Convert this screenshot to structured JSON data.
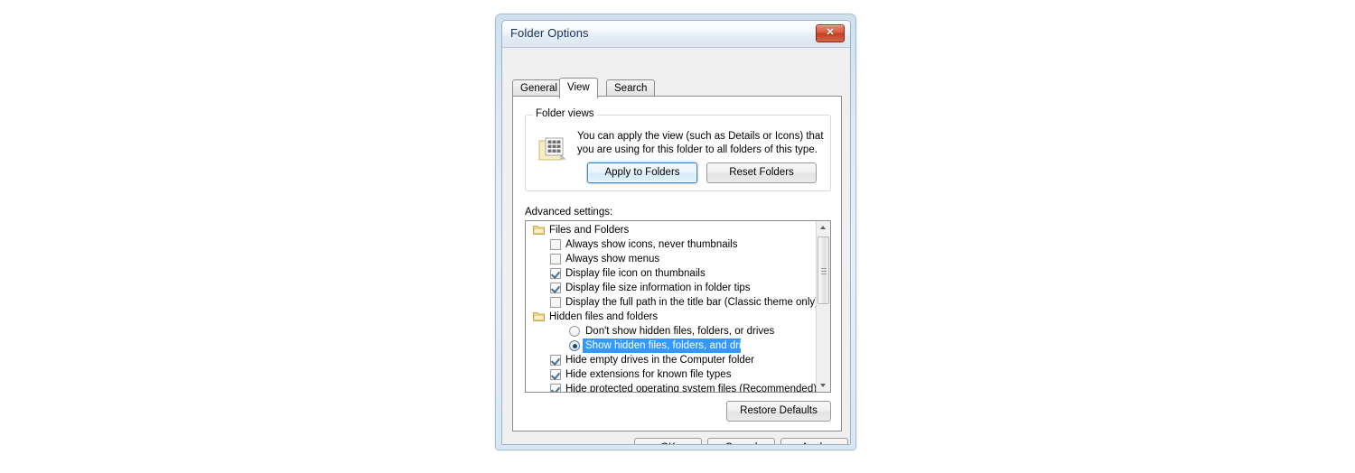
{
  "window": {
    "title": "Folder Options",
    "close_label": "✕",
    "close_icon": "close-icon"
  },
  "tabs": [
    {
      "label": "General",
      "selected": false
    },
    {
      "label": "View",
      "selected": true
    },
    {
      "label": "Search",
      "selected": false
    }
  ],
  "folder_views": {
    "group_title": "Folder views",
    "description": "You can apply the view (such as Details or Icons) that you are using for this folder to all folders of this type.",
    "icon": "folder-view-icon",
    "apply_button": "Apply to Folders",
    "reset_button": "Reset Folders"
  },
  "advanced": {
    "label": "Advanced settings:",
    "items": [
      {
        "type": "group",
        "label": "Files and Folders",
        "icon": "folder-icon"
      },
      {
        "type": "checkbox",
        "label": "Always show icons, never thumbnails",
        "checked": false
      },
      {
        "type": "checkbox",
        "label": "Always show menus",
        "checked": false
      },
      {
        "type": "checkbox",
        "label": "Display file icon on thumbnails",
        "checked": true
      },
      {
        "type": "checkbox",
        "label": "Display file size information in folder tips",
        "checked": true
      },
      {
        "type": "checkbox",
        "label": "Display the full path in the title bar (Classic theme only)",
        "checked": false
      },
      {
        "type": "group",
        "label": "Hidden files and folders",
        "icon": "folder-icon"
      },
      {
        "type": "radio",
        "label": "Don't show hidden files, folders, or drives",
        "selected": false,
        "highlighted": false
      },
      {
        "type": "radio",
        "label": "Show hidden files, folders, and drives",
        "selected": true,
        "highlighted": true
      },
      {
        "type": "checkbox",
        "label": "Hide empty drives in the Computer folder",
        "checked": true
      },
      {
        "type": "checkbox",
        "label": "Hide extensions for known file types",
        "checked": true
      },
      {
        "type": "checkbox",
        "label": "Hide protected operating system files (Recommended)",
        "checked": true
      }
    ],
    "scrollbar": {
      "up_icon": "scroll-up-arrow-icon",
      "down_icon": "scroll-down-arrow-icon"
    },
    "restore_button": "Restore Defaults"
  },
  "footer": {
    "ok": "OK",
    "cancel": "Cancel",
    "apply": "Apply"
  },
  "colors": {
    "selection_blue": "#3399ff",
    "title_text": "#15315b",
    "close_red": "#c23f22",
    "focus_ring": "#3c7fb1"
  }
}
